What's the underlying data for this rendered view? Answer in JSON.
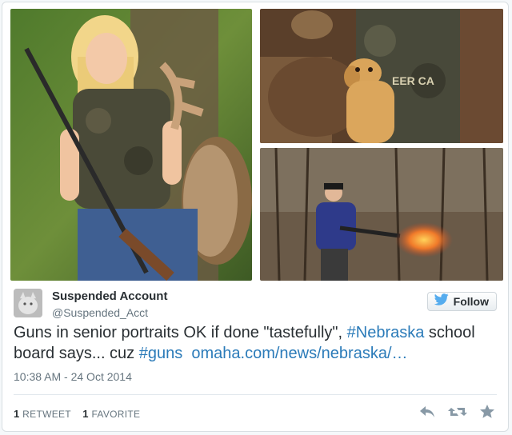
{
  "tweet": {
    "author_name": "Suspended Account",
    "author_handle": "@Suspended_Acct",
    "follow_label": "Follow",
    "text_before": "Guns in senior portraits OK if done \"tastefully\", ",
    "hashtag_1": "#Nebraska",
    "text_middle": " school board says... cuz ",
    "hashtag_2": "#guns",
    "link_text": "omaha.com/news/nebraska/…",
    "timestamp": "10:38 AM - 24 Oct 2014",
    "retweet_count": "1",
    "retweet_label": "RETWEET",
    "favorite_count": "1",
    "favorite_label": "FAVORITE"
  },
  "icons": {
    "follow": "twitter-bird-icon",
    "reply": "reply-icon",
    "retweet": "retweet-icon",
    "favorite": "star-icon"
  },
  "colors": {
    "link": "#2b7bb9",
    "twitter_blue": "#55acee",
    "muted": "#66757f",
    "action_icon": "#8899a6"
  },
  "media": [
    {
      "description_key": "photo-girl-with-gun"
    },
    {
      "description_key": "photo-dog-with-man"
    },
    {
      "description_key": "photo-shotgun-firing"
    }
  ]
}
